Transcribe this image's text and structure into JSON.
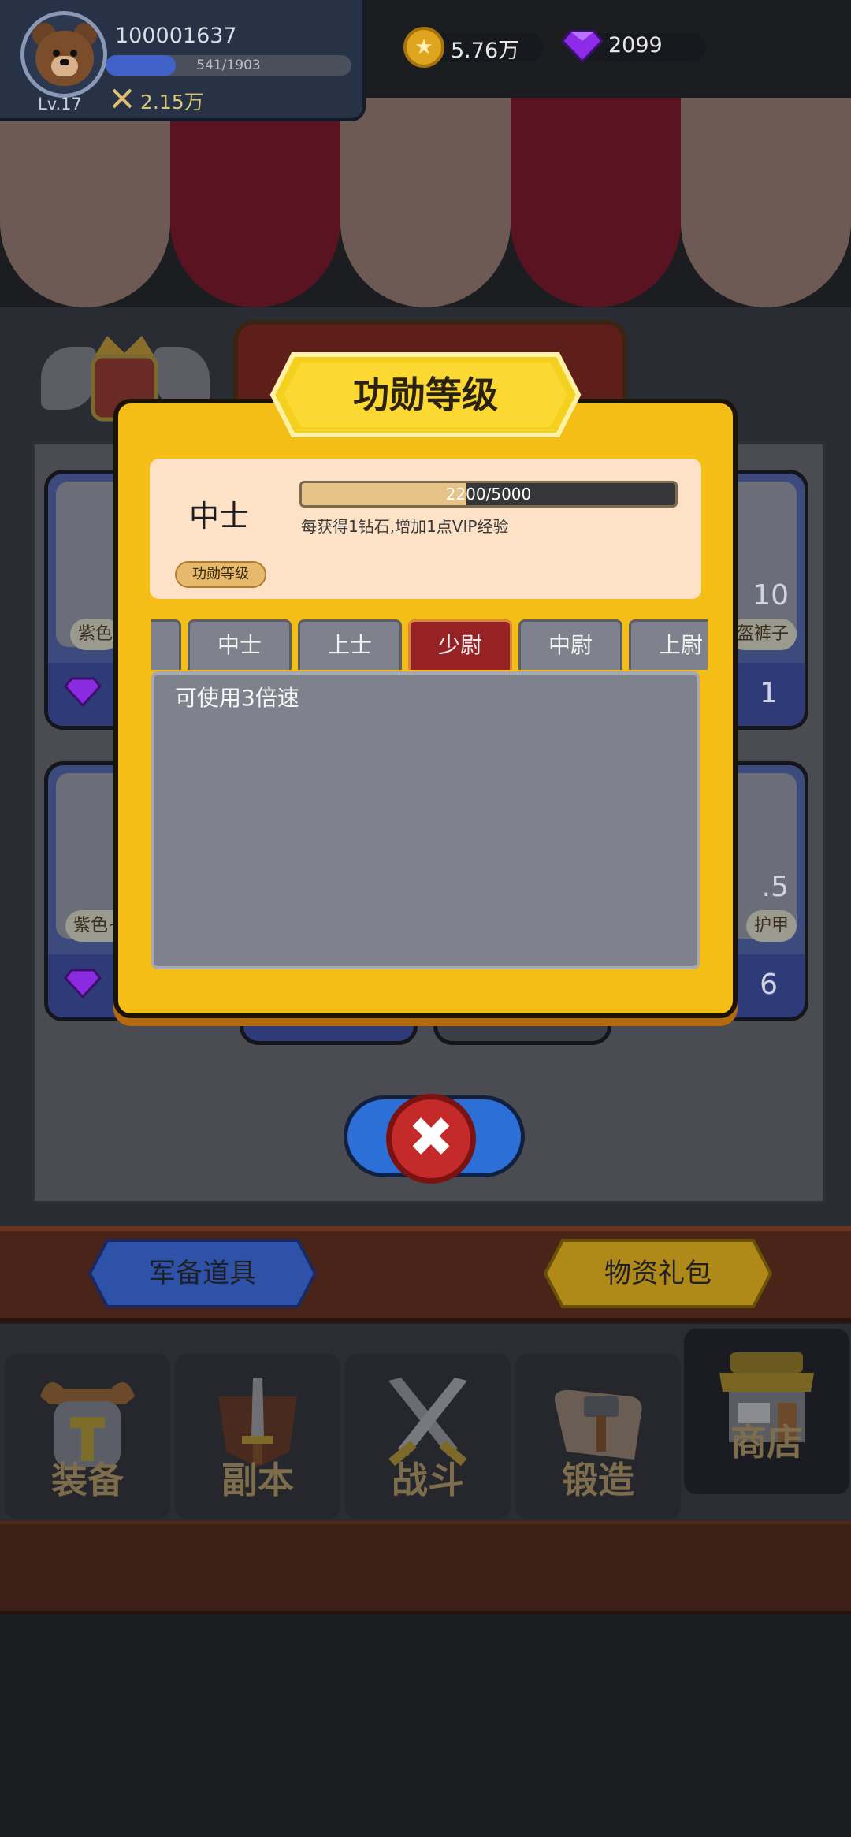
{
  "player": {
    "id": "100001637",
    "exp_text": "541/1903",
    "exp_progress": 0.284,
    "level": "Lv.17",
    "power": "2.15万"
  },
  "currency": {
    "coins": "5.76万",
    "gems": "2099"
  },
  "background": {
    "card_labels": [
      "紫色",
      "盔裤子",
      "紫色~",
      "护甲"
    ],
    "card_numbers": [
      "10",
      "1",
      ".5",
      "6"
    ],
    "badge_text": "中士"
  },
  "modal": {
    "title": "功勋等级",
    "current_rank": "中士",
    "progress_text": "2200/5000",
    "progress": 0.44,
    "description": "每获得1钻石,增加1点VIP经验",
    "chip_label": "功勋等级",
    "tabs": [
      "",
      "中士",
      "上士",
      "少尉",
      "中尉",
      "上尉"
    ],
    "active_tab": "少尉",
    "content_text": "可使用3倍速"
  },
  "bottom_buttons": {
    "left": "军备道具",
    "right": "物资礼包"
  },
  "nav": {
    "items": [
      "装备",
      "副本",
      "战斗",
      "锻造",
      "商店"
    ],
    "active": "商店"
  },
  "colors": {
    "modal_yellow": "#f5be17",
    "tab_active": "#962224",
    "close_red": "#c42a2a"
  },
  "icons": [
    "bear-avatar-icon",
    "crossed-swords-icon",
    "gold-coin-icon",
    "purple-gem-icon",
    "close-icon"
  ]
}
